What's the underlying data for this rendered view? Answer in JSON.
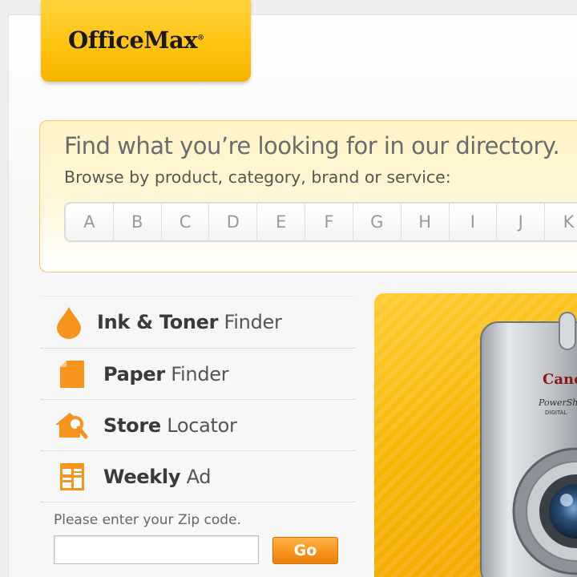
{
  "header": {
    "logo_text": "OfficeMax",
    "logo_tm": "®",
    "brand_color": "#ffc20e"
  },
  "directory": {
    "title": "Find what you’re looking for in our directory.",
    "subtitle": "Browse by product, category, brand or service:",
    "letters": [
      "A",
      "B",
      "C",
      "D",
      "E",
      "F",
      "G",
      "H",
      "I",
      "J",
      "K"
    ]
  },
  "nav": {
    "items": [
      {
        "bold": "Ink & Toner",
        "light": "Finder",
        "icon": "ink-drop-icon"
      },
      {
        "bold": "Paper",
        "light": "Finder",
        "icon": "paper-icon"
      },
      {
        "bold": "Store",
        "light": "Locator",
        "icon": "store-locator-icon"
      },
      {
        "bold": "Weekly",
        "light": "Ad",
        "icon": "weekly-ad-icon"
      }
    ],
    "icon_color": "#f7941d"
  },
  "zip": {
    "label": "Please enter your Zip code.",
    "value": "",
    "button_label": "Go"
  },
  "promo": {
    "camera_brand": "Canon",
    "camera_model": "PowerShot",
    "camera_sub": "DIGITAL"
  }
}
